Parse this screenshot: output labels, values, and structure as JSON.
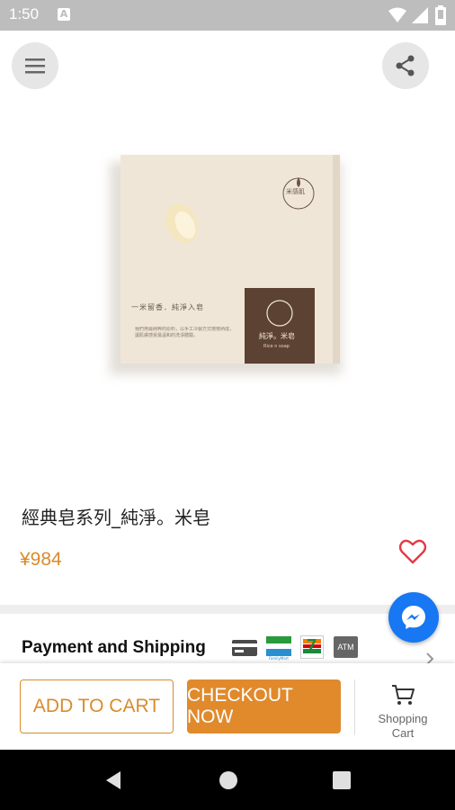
{
  "status_bar": {
    "time": "1:50",
    "notification_letter": "A"
  },
  "header": {
    "menu_icon": "hamburger-menu-icon",
    "share_icon": "share-icon"
  },
  "product": {
    "title": "經典皂系列_純淨。米皂",
    "price": "¥984",
    "image": {
      "brand_mark": "米感肌",
      "tagline": "一米留香．純淨入皂",
      "body_text": "我們用最純粹的原料，以手工冷製方式慢慢熟成，讓肌膚感受最溫和的洗淨體驗。",
      "label_char": "米",
      "label_name": "純淨。米皂",
      "label_en": "Rice n soap"
    }
  },
  "sections": {
    "payment_shipping": "Payment and Shipping"
  },
  "payment_icons": [
    "credit-card-icon",
    "familymart-icon",
    "seven-eleven-icon",
    "atm-icon"
  ],
  "payment_labels": {
    "familymart": "FamilyMart",
    "atm": "ATM"
  },
  "actions": {
    "add_to_cart": "ADD TO CART",
    "checkout": "CHECKOUT NOW",
    "cart_label_1": "Shopping",
    "cart_label_2": "Cart"
  },
  "colors": {
    "accent": "#d98b2b",
    "messenger": "#1877f2",
    "heart": "#e53945"
  }
}
